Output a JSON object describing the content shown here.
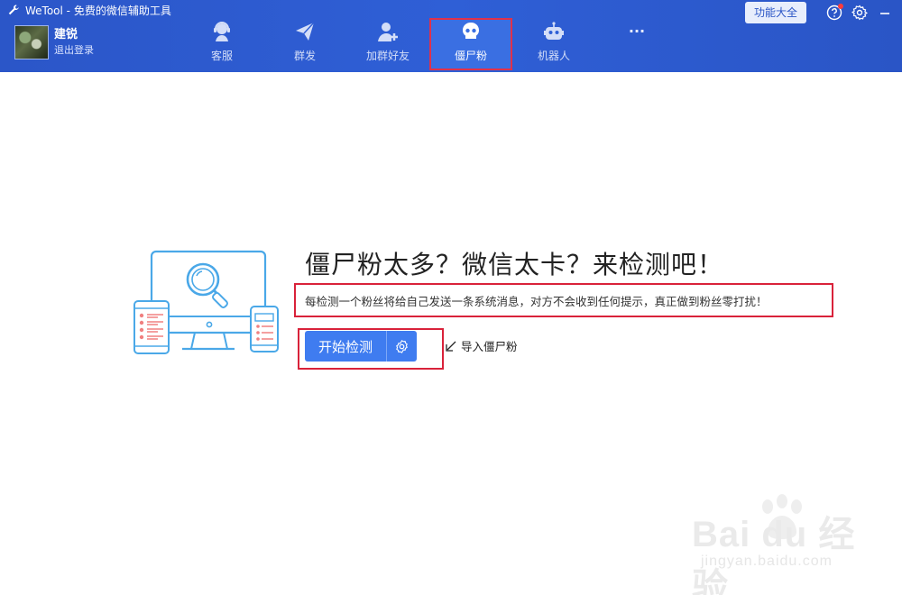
{
  "window": {
    "title": "WeTool - 免费的微信辅助工具"
  },
  "user": {
    "name": "建锐",
    "logout_label": "退出登录"
  },
  "top_right": {
    "feature_button": "功能大全"
  },
  "nav": {
    "items": [
      {
        "label": "客服",
        "icon": "customer-service-icon"
      },
      {
        "label": "群发",
        "icon": "paper-plane-icon"
      },
      {
        "label": "加群好友",
        "icon": "add-friend-icon"
      },
      {
        "label": "僵尸粉",
        "icon": "skull-icon",
        "active": true
      },
      {
        "label": "机器人",
        "icon": "robot-icon"
      },
      {
        "label": "···",
        "icon": "more-icon"
      }
    ]
  },
  "main": {
    "headline": "僵尸粉太多？微信太卡？来检测吧！",
    "description": "每检测一个粉丝将给自己发送一条系统消息，对方不会收到任何提示，真正做到粉丝零打扰！",
    "start_button": "开始检测",
    "import_label": "导入僵尸粉"
  },
  "watermark": {
    "brand": "Bai du 经验",
    "url": "jingyan.baidu.com"
  },
  "colors": {
    "header": "#2f5fd6",
    "primary": "#3f7cf0",
    "highlight": "#d9223a",
    "illustration": "#4aa8e8"
  }
}
